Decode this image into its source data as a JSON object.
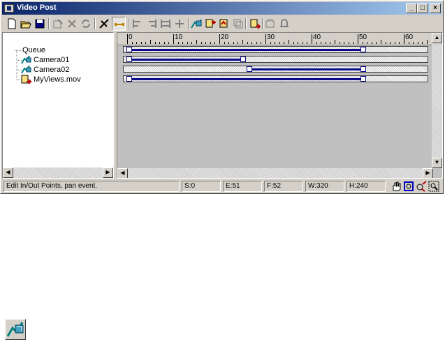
{
  "window": {
    "title": "Video Post"
  },
  "title_buttons": [
    "_",
    "□",
    "×"
  ],
  "toolbar": {
    "tools": [
      "new-sequence-icon",
      "open-sequence-icon",
      "save-sequence-icon",
      "edit-event-icon",
      "delete-event-icon",
      "swap-events-icon",
      "execute-sequence-icon",
      "edit-range-bar-icon",
      "align-left-icon",
      "align-right-icon",
      "make-same-size-icon",
      "abut-selected-icon",
      "add-scene-event-icon",
      "add-image-input-event-icon",
      "add-image-filter-event-icon",
      "add-image-layer-event-icon",
      "add-image-output-event-icon",
      "add-external-event-icon",
      "add-loop-event-icon"
    ]
  },
  "ruler": {
    "labels": [
      "0",
      "10",
      "20",
      "30",
      "40",
      "50",
      "60"
    ]
  },
  "tree": {
    "items": [
      {
        "label": "Queue"
      },
      {
        "label": "Camera01"
      },
      {
        "label": "Camera02"
      },
      {
        "label": "MyViews.mov"
      }
    ]
  },
  "tracks": [
    {
      "start": 0,
      "end": 51
    },
    {
      "start": 0,
      "end": 25
    },
    {
      "start": 26,
      "end": 51
    },
    {
      "start": 0,
      "end": 51
    }
  ],
  "status": {
    "prompt": "Edit In/Out Points, pan event.",
    "start": "S:0",
    "end": "E:51",
    "frames": "F:52",
    "width": "W:320",
    "height": "H:240"
  },
  "colors": {
    "titlebar_start": "#0a246a",
    "range_bar": "#0a0a8a",
    "face": "#d4d0c8"
  }
}
